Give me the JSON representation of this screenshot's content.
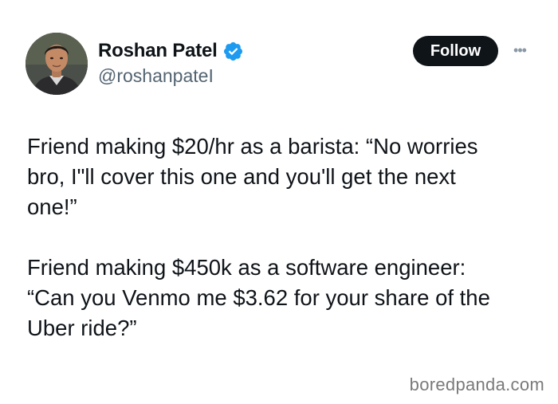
{
  "author": {
    "display_name": "Roshan Patel",
    "handle": "@roshanpateI",
    "verified": true,
    "verified_icon": "verified-badge-icon",
    "verified_color": "#1d9bf0",
    "avatar_icon": "profile-photo"
  },
  "actions": {
    "follow_label": "Follow",
    "more_icon": "more-horizontal-icon",
    "more_glyph": "•••"
  },
  "tweet": {
    "paragraphs": [
      {
        "lines": [
          "Friend making $20/hr as a barista: “No worries",
          "bro, I\"ll cover this one and you'll get the next",
          "one!”"
        ]
      },
      {
        "lines": [
          "Friend making $450k as a software engineer:",
          "“Can you Venmo me $3.62 for your share of the",
          "Uber ride?”"
        ]
      }
    ]
  },
  "watermark": {
    "text": "boredpanda.com"
  },
  "colors": {
    "text_primary": "#0f1419",
    "text_secondary": "#536471",
    "follow_bg": "#0f1419",
    "follow_text": "#ffffff",
    "watermark": "#7a7a7a"
  }
}
